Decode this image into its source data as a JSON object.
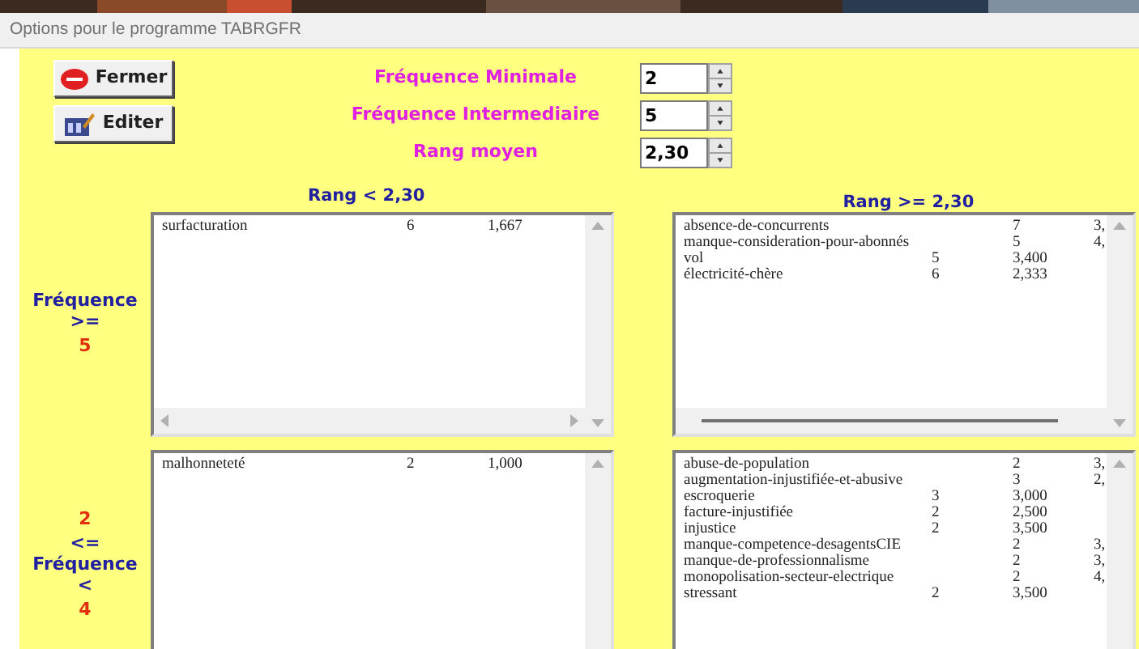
{
  "window": {
    "title": "Options pour le programme TABRGFR"
  },
  "buttons": [
    {
      "label": "Fermer",
      "kind": "stop"
    },
    {
      "label": "Editer",
      "kind": "edit"
    }
  ],
  "fields": [
    {
      "label": "Fréquence Minimale",
      "value": "2"
    },
    {
      "label": "Fréquence Intermediaire",
      "value": "5"
    },
    {
      "label": "Rang moyen",
      "value": "2,30"
    }
  ],
  "rank_headers": [
    "Rang < 2,30",
    "Rang >= 2,30"
  ],
  "bands": [
    {
      "label_lines": [
        {
          "text": "Fréquence",
          "kind": "word"
        },
        {
          "text": ">=",
          "kind": "word"
        },
        {
          "text": "5",
          "kind": "value"
        }
      ],
      "lists": [
        {
          "rows": [
            {
              "name": "surfacturation",
              "count": "6",
              "rank": "1,667",
              "kind": "short"
            }
          ]
        },
        {
          "rows": [
            {
              "name": "absence-de-concurrents",
              "count": "7",
              "rank": "3,",
              "kind": "long"
            },
            {
              "name": "manque-consideration-pour-abonnés",
              "count": "5",
              "rank": "4,",
              "kind": "long"
            },
            {
              "name": "vol",
              "count": "5",
              "rank": "3,400",
              "kind": "short"
            },
            {
              "name": "électricité-chère",
              "count": "6",
              "rank": "2,333",
              "kind": "short"
            }
          ]
        }
      ]
    },
    {
      "label_lines": [
        {
          "text": "2",
          "kind": "value"
        },
        {
          "text": "<=",
          "kind": "word"
        },
        {
          "text": "Fréquence",
          "kind": "word"
        },
        {
          "text": "<",
          "kind": "word"
        },
        {
          "text": "4",
          "kind": "value"
        }
      ],
      "lists": [
        {
          "rows": [
            {
              "name": "malhonneteté",
              "count": "2",
              "rank": "1,000",
              "kind": "short"
            }
          ]
        },
        {
          "rows": [
            {
              "name": "abuse-de-population",
              "count": "2",
              "rank": "3,",
              "kind": "long"
            },
            {
              "name": "augmentation-injustifiée-et-abusive",
              "count": "3",
              "rank": "2,",
              "kind": "long"
            },
            {
              "name": "escroquerie",
              "count": "3",
              "rank": "3,000",
              "kind": "short"
            },
            {
              "name": "facture-injustifiée",
              "count": "2",
              "rank": "2,500",
              "kind": "short"
            },
            {
              "name": "injustice",
              "count": "2",
              "rank": "3,500",
              "kind": "short"
            },
            {
              "name": "manque-competence-desagentsCIE",
              "count": "2",
              "rank": "3,",
              "kind": "long"
            },
            {
              "name": "manque-de-professionnalisme",
              "count": "2",
              "rank": "3,",
              "kind": "long"
            },
            {
              "name": "monopolisation-secteur-electrique",
              "count": "2",
              "rank": "4,",
              "kind": "long"
            },
            {
              "name": "stressant",
              "count": "2",
              "rank": "3,500",
              "kind": "short"
            }
          ]
        }
      ]
    }
  ]
}
